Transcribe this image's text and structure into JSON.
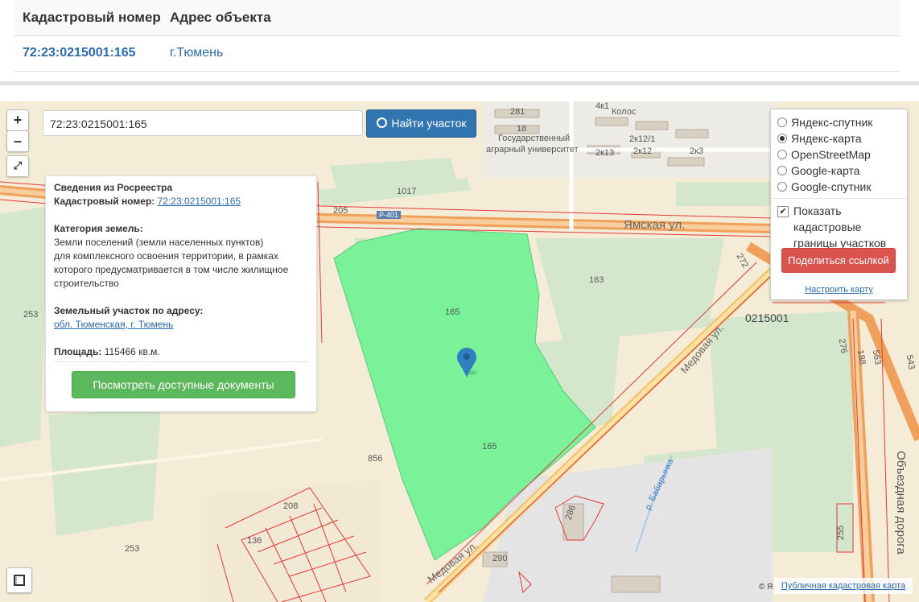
{
  "table": {
    "headers": [
      "Кадастровый номер",
      "Адрес объекта"
    ],
    "row": {
      "cadastral_number": "72:23:0215001:165",
      "address": "г.Тюмень"
    }
  },
  "map": {
    "zoom_in": "+",
    "zoom_out": "–",
    "search_value": "72:23:0215001:165",
    "find_button": "Найти участок",
    "labels": [
      {
        "text": "Государственный"
      },
      {
        "text": "аграрный университет"
      },
      {
        "text": "Колос"
      },
      {
        "text": "281"
      },
      {
        "text": "18"
      },
      {
        "text": "4к1"
      },
      {
        "text": "2к13"
      },
      {
        "text": "2к12/1"
      },
      {
        "text": "2к12"
      },
      {
        "text": "2к3"
      },
      {
        "text": "1017"
      },
      {
        "text": "205"
      },
      {
        "text": "Р-401"
      },
      {
        "text": "Ямская ул."
      },
      {
        "text": "163"
      },
      {
        "text": "165"
      },
      {
        "text": "165"
      },
      {
        "text": "0215001"
      },
      {
        "text": "Медовая ул."
      },
      {
        "text": "Медовая ул."
      },
      {
        "text": "856"
      },
      {
        "text": "253"
      },
      {
        "text": "253"
      },
      {
        "text": "208"
      },
      {
        "text": "136"
      },
      {
        "text": "286"
      },
      {
        "text": "290"
      },
      {
        "text": "р. Бабарынка"
      },
      {
        "text": "255"
      },
      {
        "text": "Объездная дорога"
      },
      {
        "text": "272"
      },
      {
        "text": "276"
      },
      {
        "text": "188"
      },
      {
        "text": "563"
      },
      {
        "text": "543"
      }
    ]
  },
  "info_panel": {
    "title": "Сведения из Росреестра",
    "cadastral_label": "Кадастровый номер:",
    "cadastral_value": "72:23:0215001:165",
    "category_label": "Категория земель:",
    "category_lines": [
      "Земли поселений (земли населенных пунктов)",
      "для комплексного освоения территории, в рамках",
      "которого предусматривается в том числе жилищное",
      "строительство"
    ],
    "address_label": "Земельный участок по адресу:",
    "address_value": "обл. Тюменская, г. Тюмень",
    "area_label": "Площадь:",
    "area_value": "115466 кв.м.",
    "docs_button": "Посмотреть доступные документы"
  },
  "layers": {
    "options": [
      {
        "label": "Яндекс-спутник",
        "selected": false
      },
      {
        "label": "Яндекс-карта",
        "selected": true
      },
      {
        "label": "OpenStreetMap",
        "selected": false
      },
      {
        "label": "Google-карта",
        "selected": false
      },
      {
        "label": "Google-спутник",
        "selected": false
      }
    ],
    "show_boundaries_label": "Показать кадастровые границы участков",
    "show_boundaries_checked": true,
    "share_button": "Поделиться ссылкой",
    "configure_link": "Настроить карту"
  },
  "footer": {
    "copyright": "© Я",
    "cadastral_map_link": "Публичная кадастровая карта"
  },
  "colors": {
    "parcel_fill": "#79f29a",
    "road": "#f6b26b",
    "main_road": "#f0a05a",
    "green_area": "#d4e7cc",
    "boundary": "#e53935",
    "marker": "#2f7fc1"
  }
}
